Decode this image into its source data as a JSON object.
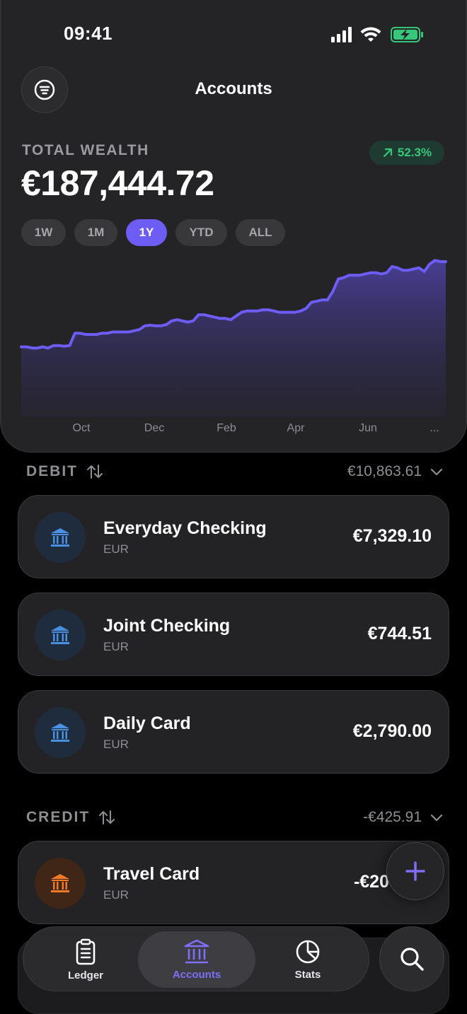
{
  "status": {
    "time": "09:41"
  },
  "header": {
    "title": "Accounts"
  },
  "wealth": {
    "label": "TOTAL WEALTH",
    "value": "€187,444.72",
    "change": "52.3%",
    "change_color": "#37c77a"
  },
  "ranges": [
    {
      "label": "1W",
      "active": false
    },
    {
      "label": "1M",
      "active": false
    },
    {
      "label": "1Y",
      "active": true
    },
    {
      "label": "YTD",
      "active": false
    },
    {
      "label": "ALL",
      "active": false
    }
  ],
  "chart_data": {
    "type": "area",
    "x_tick_labels": [
      "Oct",
      "Dec",
      "Feb",
      "Apr",
      "Jun",
      "..."
    ],
    "values": [
      0.57,
      0.57,
      0.56,
      0.56,
      0.57,
      0.56,
      0.58,
      0.58,
      0.575,
      0.58,
      0.68,
      0.68,
      0.67,
      0.67,
      0.67,
      0.68,
      0.68,
      0.69,
      0.69,
      0.69,
      0.69,
      0.7,
      0.71,
      0.74,
      0.745,
      0.74,
      0.74,
      0.75,
      0.78,
      0.79,
      0.78,
      0.77,
      0.78,
      0.83,
      0.83,
      0.82,
      0.81,
      0.8,
      0.8,
      0.79,
      0.82,
      0.85,
      0.86,
      0.86,
      0.86,
      0.87,
      0.87,
      0.86,
      0.85,
      0.85,
      0.85,
      0.85,
      0.86,
      0.88,
      0.93,
      0.94,
      0.95,
      0.95,
      1.02,
      1.12,
      1.13,
      1.15,
      1.15,
      1.15,
      1.16,
      1.17,
      1.17,
      1.16,
      1.17,
      1.22,
      1.21,
      1.19,
      1.19,
      1.2,
      1.21,
      1.18,
      1.24,
      1.27,
      1.26,
      1.26
    ],
    "color": "#6d5df5",
    "grid": false,
    "legend": "none"
  },
  "debit": {
    "title": "DEBIT",
    "total": "€10,863.61",
    "accounts": [
      {
        "name": "Everyday Checking",
        "currency": "EUR",
        "balance": "€7,329.10"
      },
      {
        "name": "Joint Checking",
        "currency": "EUR",
        "balance": "€744.51"
      },
      {
        "name": "Daily Card",
        "currency": "EUR",
        "balance": "€2,790.00"
      }
    ],
    "icon_color": "#4a90e2"
  },
  "credit": {
    "title": "CREDIT",
    "total": "-€425.91",
    "accounts": [
      {
        "name": "Travel Card",
        "currency": "EUR",
        "balance": "-€20"
      }
    ],
    "icon_color": "#f07a2a"
  },
  "nav": {
    "tabs": [
      {
        "label": "Ledger",
        "icon": "ledger-icon"
      },
      {
        "label": "Accounts",
        "icon": "bank-icon"
      },
      {
        "label": "Stats",
        "icon": "pie-chart-icon"
      }
    ],
    "active_color": "#7d6ff7"
  }
}
